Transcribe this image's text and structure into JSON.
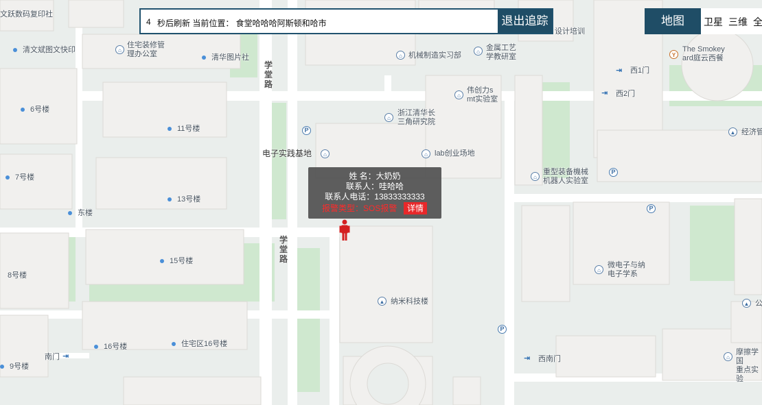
{
  "topbar": {
    "countdown": "4",
    "refresh_and_location": "秒后刷新  当前位置：  食堂哈哈哈阿斯顿和哈市",
    "exit_button": "退出追踪"
  },
  "map_type": {
    "map": "地图",
    "satellite": "卫星",
    "three_d": "三维",
    "fullscreen": "全"
  },
  "info_window": {
    "name_line": "姓  名：大奶奶",
    "contact_line": "联系人：哇哈哈",
    "phone_line": "联系人电话：13833333333",
    "alarm_line": "报警类型：SOS报警",
    "detail_button": "详情"
  },
  "map_labels": {
    "nanochip_top_left": "文跃数码复印社",
    "qingwen": "清文斌图文快印",
    "housing_office": "住宅装修管\n理办公室",
    "qinghua_picture": "清华图片社",
    "machinery_lab": "机械制造实习部",
    "jinwei": "金属工艺\n学教研室",
    "design_training": "设计培训",
    "smokey": "The Smokey\nard庭云西餐",
    "west1": "西1门",
    "west2": "西2门",
    "weichuangli": "伟创力s\nmt实验室",
    "zhejiang_qinghua": "浙江清华长\n三角研究院",
    "econ": "经济管",
    "building6": "6号楼",
    "building11": "11号楼",
    "electronic_base": "电子实践基地",
    "lab_venture": "lab创业场地",
    "heavy_equipment": "重型装备機械\n机器人实验室",
    "building7": "7号楼",
    "building13": "13号楼",
    "east_building": "东楼",
    "building15": "15号楼",
    "building8": "8号楼",
    "micro_electronics": "微电子与纳\n电子学系",
    "nano_building": "纳米科技楼",
    "gong": "公",
    "building16": "16号楼",
    "residential16": "住宅区16号楼",
    "south_gate": "南门",
    "west_south_gate": "西南门",
    "building9": "9号楼",
    "moshe": "摩擦学国\n重点实验"
  },
  "roads": {
    "xuetang_north": "学堂路",
    "xuetang_south": "学堂路"
  },
  "colors": {
    "accent_dark": "#1f4d66",
    "alarm_red": "#ff2a2a",
    "detail_btn": "#e8282a",
    "marker_red": "#d42020",
    "poi_blue": "#4a8fd8"
  }
}
